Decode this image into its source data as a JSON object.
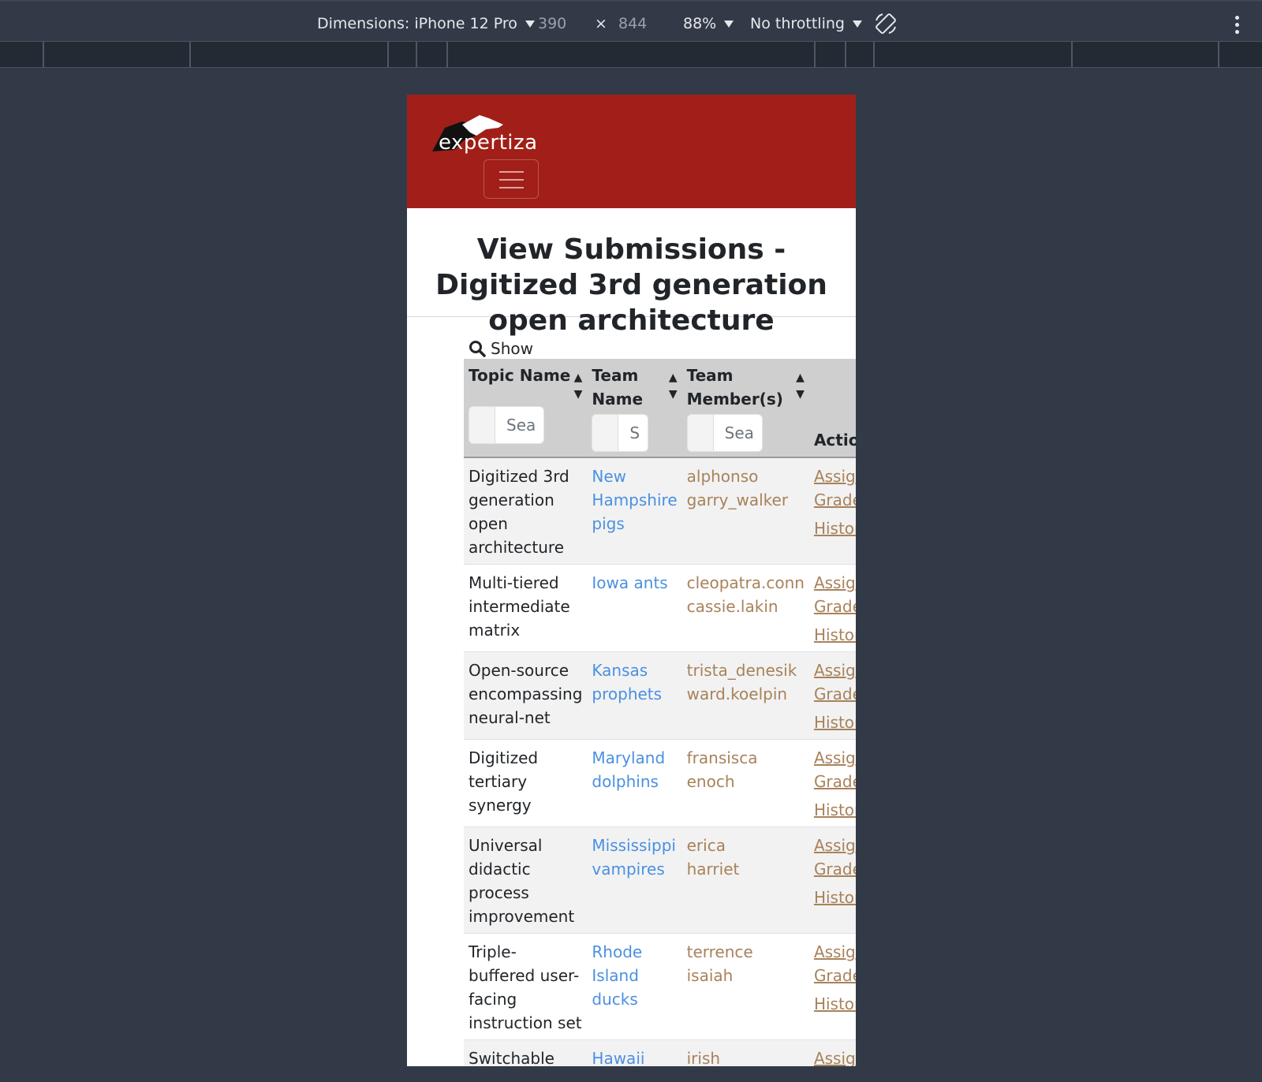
{
  "devtools": {
    "dimensions_label": "Dimensions: iPhone 12 Pro",
    "width": "390",
    "times": "×",
    "height": "844",
    "zoom": "88%",
    "throttling": "No throttling",
    "rotate_icon": "rotate-icon"
  },
  "navbar": {
    "brand": "expertiza",
    "color": "#a11f18"
  },
  "page": {
    "title": "View Submissions - Digitized 3rd generation open architecture",
    "show_label": "Show"
  },
  "table": {
    "headers": {
      "topic": "Topic Name",
      "team": "Team Name",
      "members": "Team Member(s)",
      "action": "Action"
    },
    "search_placeholders": {
      "topic": "Sea",
      "team": "S",
      "members": "Sea"
    },
    "rows": [
      {
        "topic": "Digitized 3rd generation open architecture",
        "team": "New Hampshire pigs",
        "members": [
          "alphonso",
          "garry_walker"
        ],
        "assign": "Assign Grade",
        "history": "History"
      },
      {
        "topic": "Multi-tiered intermediate matrix",
        "team": "Iowa ants",
        "members": [
          "cleopatra.conn",
          "cassie.lakin"
        ],
        "assign": "Assign Grade",
        "history": "History"
      },
      {
        "topic": "Open-source encompassing neural-net",
        "team": "Kansas prophets",
        "members": [
          "trista_denesik",
          "ward.koelpin"
        ],
        "assign": "Assign Grade",
        "history": "History"
      },
      {
        "topic": "Digitized tertiary synergy",
        "team": "Maryland dolphins",
        "members": [
          "fransisca",
          "enoch"
        ],
        "assign": "Assign Grade",
        "history": "History"
      },
      {
        "topic": "Universal didactic process improvement",
        "team": "Mississippi vampires",
        "members": [
          "erica",
          "harriet"
        ],
        "assign": "Assign Grade",
        "history": "History"
      },
      {
        "topic": "Triple-buffered user-facing instruction set",
        "team": "Rhode Island ducks",
        "members": [
          "terrence",
          "isaiah"
        ],
        "assign": "Assign Grade",
        "history": "History"
      },
      {
        "topic": "Switchable",
        "team": "Hawaii",
        "members": [
          "irish"
        ],
        "assign": "Assign",
        "history": ""
      }
    ]
  }
}
